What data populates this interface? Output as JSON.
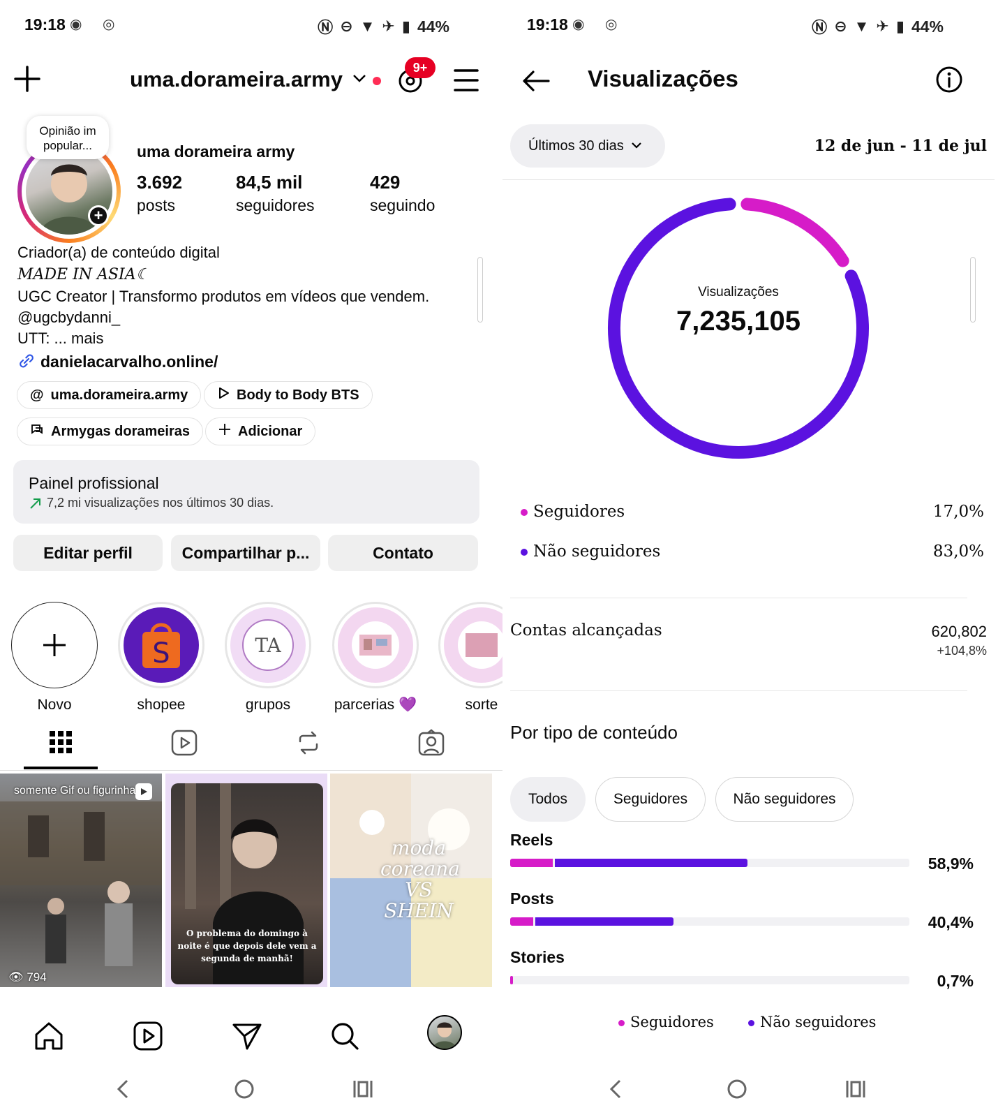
{
  "status": {
    "time": "19:18",
    "battery": "44%"
  },
  "left": {
    "username": "uma.dorameira.army",
    "notif_badge": "9+",
    "note_bubble": "Opinião im popular...",
    "display_name": "uma dorameira army",
    "stats": [
      {
        "value": "3.692",
        "label": "posts"
      },
      {
        "value": "84,5 mil",
        "label": "seguidores"
      },
      {
        "value": "429",
        "label": "seguindo"
      }
    ],
    "category": "Criador(a) de conteúdo digital",
    "bio": [
      "MADE IN ASIA☾",
      "UGC Creator | Transformo produtos em vídeos que vendem.",
      "@ugcbydanni_",
      "UTT: ... mais"
    ],
    "link": "danielacarvalho.online/",
    "chips": [
      {
        "label": "uma.dorameira.army",
        "icon": "threads-icon"
      },
      {
        "label": "Body to Body BTS",
        "icon": "play-icon"
      },
      {
        "label": "Armygas dorameiras",
        "icon": "chat-icon"
      },
      {
        "label": "Adicionar",
        "icon": "plus-icon"
      }
    ],
    "pro_panel": {
      "title": "Painel profissional",
      "subtitle": "7,2 mi visualizações nos últimos 30 dias."
    },
    "buttons": [
      "Editar perfil",
      "Compartilhar p...",
      "Contato"
    ],
    "highlights": [
      "Novo",
      "shopee",
      "grupos",
      "parcerias 💜",
      "sorte"
    ],
    "grid": [
      {
        "caption": "somente Gif ou figurinha",
        "views": "794"
      },
      {
        "caption": "O problema do domingo à noite é que depois dele vem a segunda de manhã!"
      },
      {
        "caption": "moda coreana VS SHEIN"
      }
    ]
  },
  "right": {
    "title": "Visualizações",
    "period": "Últimos 30 dias",
    "date_range": "12 de jun - 11 de jul",
    "donut_label": "Visualizações",
    "total": "7,235,105",
    "breakdown": [
      {
        "label": "Seguidores",
        "value": "17,0%",
        "color": "#d61cc8"
      },
      {
        "label": "Não seguidores",
        "value": "83,0%",
        "color": "#5b12e0"
      }
    ],
    "reach": {
      "label": "Contas alcançadas",
      "value": "620,802",
      "change": "+104,8%"
    },
    "content_section": "Por tipo de conteúdo",
    "filters": [
      "Todos",
      "Seguidores",
      "Não seguidores"
    ],
    "content_types": [
      {
        "label": "Reels",
        "pct": "58,9%",
        "followers": 0.106,
        "nonfollowers": 0.483
      },
      {
        "label": "Posts",
        "pct": "40,4%",
        "followers": 0.058,
        "nonfollowers": 0.346
      },
      {
        "label": "Stories",
        "pct": "0,7%",
        "followers": 0.007,
        "nonfollowers": 0.0
      }
    ],
    "legend": [
      "Seguidores",
      "Não seguidores"
    ]
  },
  "chart_data": {
    "type": "pie",
    "title": "Visualizações",
    "categories": [
      "Seguidores",
      "Não seguidores"
    ],
    "values": [
      17.0,
      83.0
    ],
    "total": 7235105
  },
  "colors": {
    "accent_followers": "#d61cc8",
    "accent_nonfollowers": "#5b12e0",
    "notification": "#e60023"
  }
}
